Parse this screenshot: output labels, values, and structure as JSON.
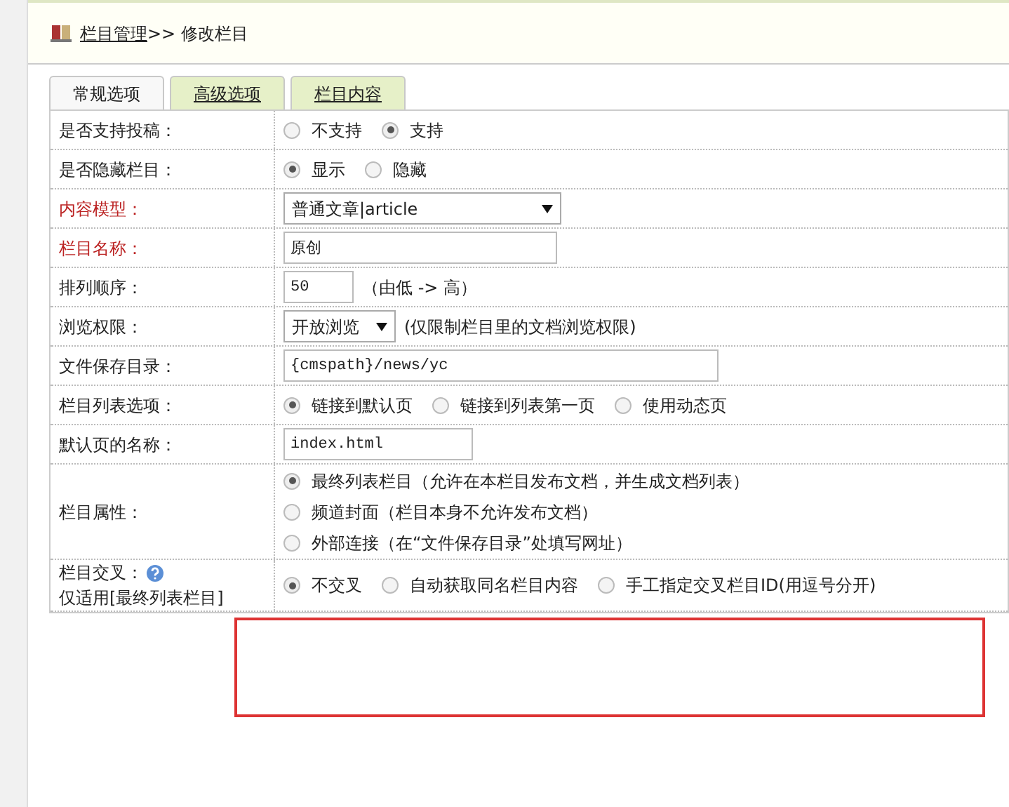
{
  "breadcrumb": {
    "link": "栏目管理",
    "separator": ">>",
    "current": "修改栏目"
  },
  "tabs": [
    {
      "label": "常规选项",
      "selected": true
    },
    {
      "label": "高级选项",
      "selected": false
    },
    {
      "label": "栏目内容",
      "selected": false
    }
  ],
  "rows": [
    {
      "label": "是否支持投稿：",
      "required": false,
      "kind": "radio",
      "options": [
        {
          "label": "不支持",
          "selected": false
        },
        {
          "label": "支持",
          "selected": true
        }
      ]
    },
    {
      "label": "是否隐藏栏目：",
      "required": false,
      "kind": "radio",
      "options": [
        {
          "label": "显示",
          "selected": true
        },
        {
          "label": "隐藏",
          "selected": false
        }
      ]
    },
    {
      "label": "内容模型：",
      "required": true,
      "kind": "select",
      "value": "普通文章|article"
    },
    {
      "label": "栏目名称：",
      "required": true,
      "kind": "text",
      "value": "原创"
    },
    {
      "label": "排列顺序：",
      "required": false,
      "kind": "text",
      "value": "50",
      "note": "（由低 -> 高）"
    },
    {
      "label": "浏览权限：",
      "required": false,
      "kind": "select",
      "value": "开放浏览",
      "note": "(仅限制栏目里的文档浏览权限)"
    },
    {
      "label": "文件保存目录：",
      "required": false,
      "kind": "text",
      "value": "{cmspath}/news/yc"
    },
    {
      "label": "栏目列表选项：",
      "required": false,
      "kind": "radio",
      "options": [
        {
          "label": "链接到默认页",
          "selected": true
        },
        {
          "label": "链接到列表第一页",
          "selected": false
        },
        {
          "label": "使用动态页",
          "selected": false
        }
      ]
    },
    {
      "label": "默认页的名称：",
      "required": false,
      "kind": "text",
      "value": "index.html"
    },
    {
      "label": "栏目属性：",
      "required": false,
      "kind": "radio_stack",
      "options": [
        {
          "label": "最终列表栏目（允许在本栏目发布文档，并生成文档列表）",
          "selected": true
        },
        {
          "label": "频道封面（栏目本身不允许发布文档）",
          "selected": false
        },
        {
          "label": "外部连接（在“文件保存目录”处填写网址）",
          "selected": false
        }
      ]
    },
    {
      "label": "栏目交叉：",
      "required": false,
      "kind": "radio",
      "help": true,
      "sublabel": "仅适用[最终列表栏目]",
      "options": [
        {
          "label": "不交叉",
          "selected": true
        },
        {
          "label": "自动获取同名栏目内容",
          "selected": false
        },
        {
          "label": "手工指定交叉栏目ID(用逗号分开)",
          "selected": false
        }
      ]
    }
  ],
  "highlight_box": {
    "visible": true
  }
}
